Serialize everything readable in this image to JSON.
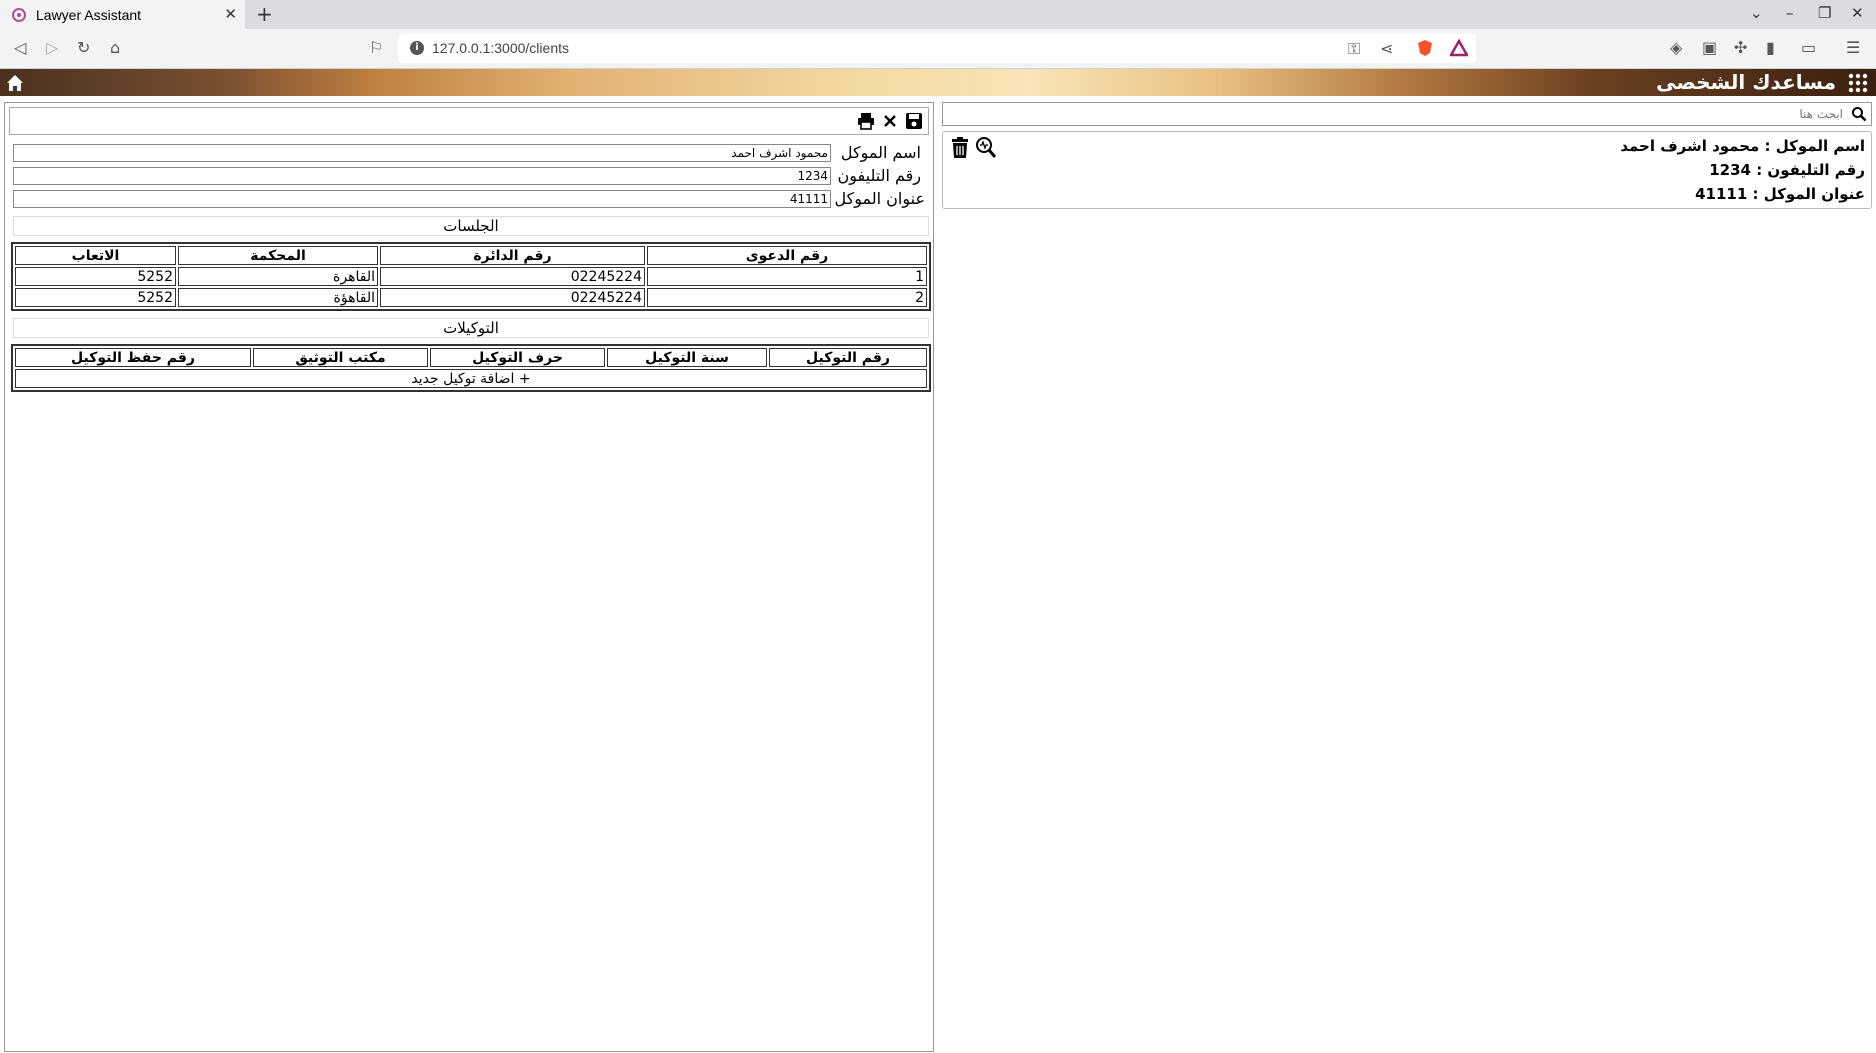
{
  "browser": {
    "tab_title": "Lawyer Assistant",
    "url": "127.0.0.1:3000/clients"
  },
  "header": {
    "title": "مساعدك الشخصى"
  },
  "search": {
    "placeholder": "ابحث هنا"
  },
  "client_card": {
    "name_line": "اسم الموكل : محمود اشرف احمد",
    "phone_line": "رقم التليفون : 1234",
    "address_line": "عنوان الموكل : 41111"
  },
  "form": {
    "name_label": "اسم الموكل",
    "name_value": "محمود اشرف احمد",
    "phone_label": "رقم التليفون",
    "phone_value": "1234",
    "address_label": "عنوان الموكل",
    "address_value": "41111"
  },
  "sessions": {
    "title": "الجلسات",
    "headers": [
      "رقم الدعوى",
      "رقم الدائرة",
      "المحكمة",
      "الاتعاب"
    ],
    "rows": [
      [
        "1",
        "02245224",
        "القاهرة",
        "5252"
      ],
      [
        "2",
        "02245224",
        "القاهؤة",
        "5252"
      ]
    ]
  },
  "powers": {
    "title": "التوكيلات",
    "headers": [
      "رقم التوكيل",
      "سنة التوكيل",
      "حرف التوكيل",
      "مكتب التوثيق",
      "رقم حفظ التوكيل"
    ],
    "add_label": "+ اضافة توكيل جديد"
  }
}
